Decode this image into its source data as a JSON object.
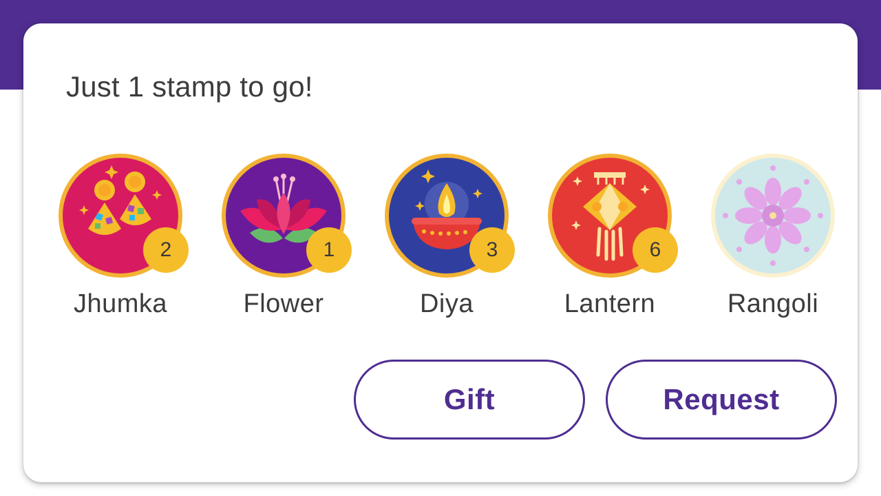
{
  "card": {
    "headline": "Just 1 stamp to go!"
  },
  "stamps": [
    {
      "label": "Jhumka",
      "count": "2",
      "icon": "jhumka-earrings-icon",
      "color": "#d81b60"
    },
    {
      "label": "Flower",
      "count": "1",
      "icon": "lotus-flower-icon",
      "color": "#6a1b9a"
    },
    {
      "label": "Diya",
      "count": "3",
      "icon": "diya-lamp-icon",
      "color": "#303f9f"
    },
    {
      "label": "Lantern",
      "count": "6",
      "icon": "lantern-icon",
      "color": "#e53935"
    },
    {
      "label": "Rangoli",
      "count": "",
      "icon": "rangoli-icon",
      "color": "#cfe8ea"
    }
  ],
  "actions": {
    "gift_label": "Gift",
    "request_label": "Request"
  },
  "colors": {
    "brand_purple": "#4f2d91",
    "badge_yellow": "#f6bd2a",
    "ring_gold": "#f2b233"
  }
}
